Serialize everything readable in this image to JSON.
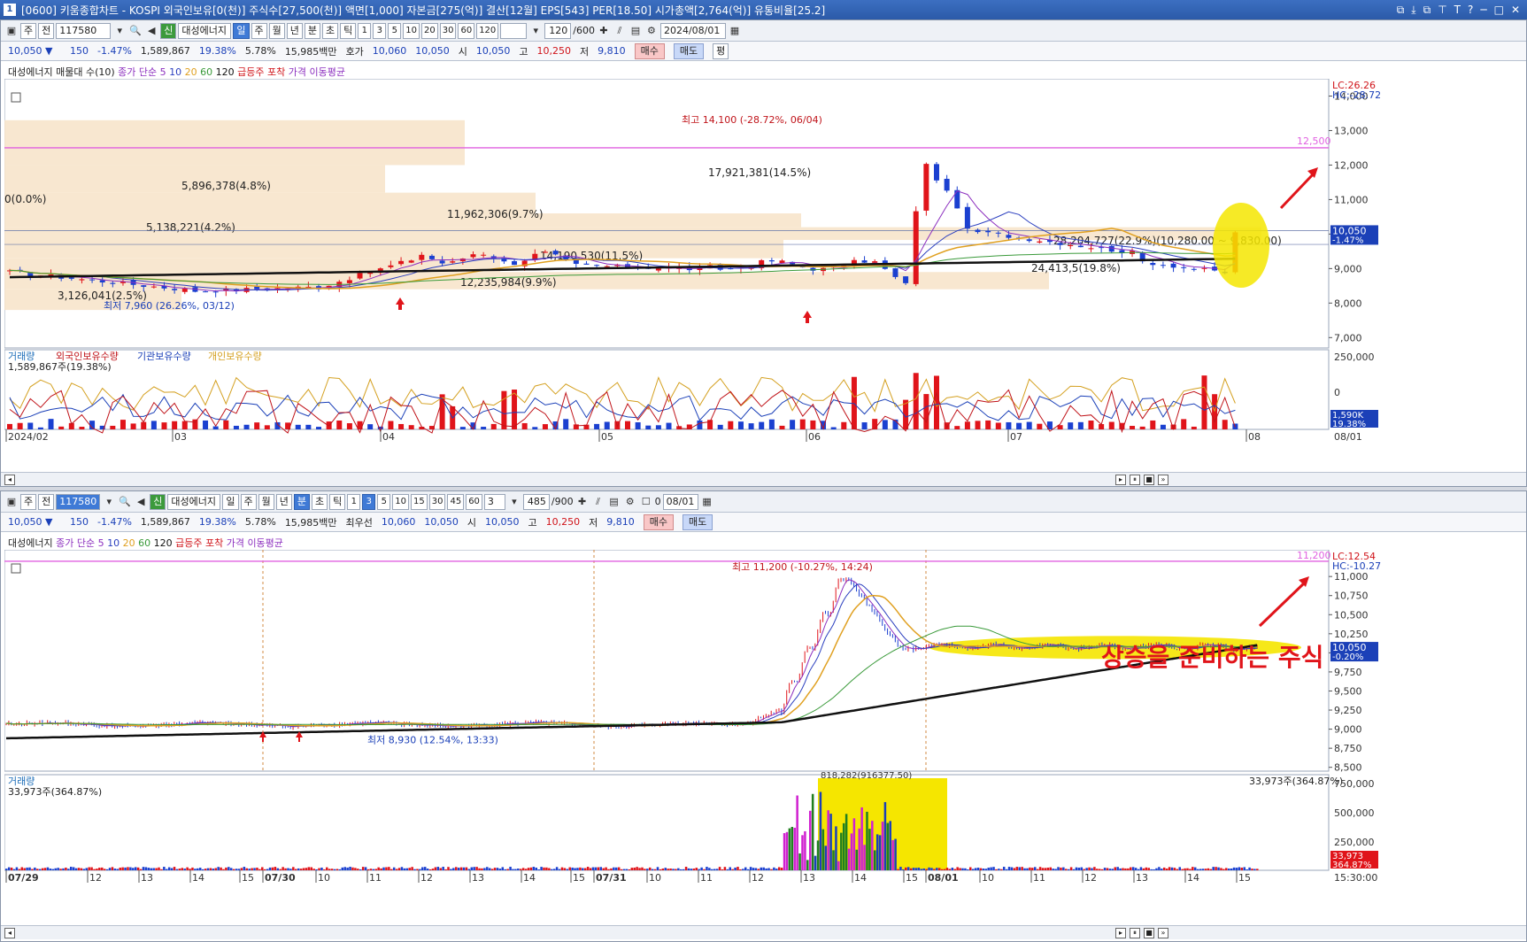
{
  "window": {
    "title": "[0600] 키움종합차트 - KOSPI 외국인보유[0(천)] 주식수[27,500(천)] 액면[1,000] 자본금[275(억)] 결산[12월] EPS[543] PER[18.50] 시가총액[2,764(억)] 유통비율[25.2]",
    "icon_label": "1",
    "controls": [
      "⧉",
      "⤓",
      "⧉",
      "⊤",
      "T",
      "?",
      "─",
      "□",
      "✕"
    ]
  },
  "top": {
    "toolbar": {
      "type_label": "주",
      "all_label": "전",
      "code": "117580",
      "mode_label": "신",
      "name": "대성에너지",
      "periods": [
        "일",
        "주",
        "월",
        "년",
        "분",
        "초",
        "틱"
      ],
      "active_period": "일",
      "nums": [
        "1",
        "3",
        "5",
        "10",
        "20",
        "30",
        "60",
        "120"
      ],
      "count": "120",
      "total": "/600",
      "date": "2024/08/01"
    },
    "quote": {
      "price": "10,050",
      "arrow": "▼",
      "change": "150",
      "rate": "-1.47%",
      "volume": "1,589,867",
      "ratio": "19.38%",
      "turnover": "5.78%",
      "amount": "15,985백만",
      "hoga_label": "호가",
      "ask": "10,060",
      "bid": "10,050",
      "open_label": "시",
      "open": "10,050",
      "high_label": "고",
      "high": "10,250",
      "low_label": "저",
      "low": "9,810",
      "buy": "매수",
      "sell": "매도",
      "avg": "평"
    },
    "legend": {
      "name": "대성에너지 매물대 수(10)",
      "ma_label": "종가 단순",
      "ma5": "5",
      "ma10": "10",
      "ma20": "20",
      "ma60": "60",
      "ma120": "120",
      "surge": "급등주 포착",
      "price_ma": "가격 이동평균"
    },
    "annotations": {
      "high": "최고 14,100 (-28.72%, 06/04)",
      "low": "최저 7,960 (26.26%, 03/12)",
      "line_value": "12,500",
      "lc": "LC:26.26",
      "hc": "HC:-28.72",
      "cur_price": "10,050",
      "cur_rate": "-1.47%"
    },
    "volume_profile": [
      {
        "label": "0(0.0%)"
      },
      {
        "label": "5,896,378(4.8%)"
      },
      {
        "label": "5,138,221(4.2%)"
      },
      {
        "label": "11,962,306(9.7%)"
      },
      {
        "label": "17,921,381(14.5%)"
      },
      {
        "label": "28,204,727(22.9%)(10,280.00 ~ 9,830.00)"
      },
      {
        "label": "14,190,530(11.5%)"
      },
      {
        "label": "12,235,984(9.9%)"
      },
      {
        "label": "24,413,5(19.8%)"
      },
      {
        "label": "3,126,041(2.5%)"
      }
    ],
    "price_axis": [
      "14,000",
      "13,000",
      "12,000",
      "11,000",
      "10,000",
      "9,000",
      "8,000",
      "7,000"
    ],
    "sub_legend": {
      "vol": "거래량",
      "foreign": "외국인보유수량",
      "inst": "기관보유수량",
      "indiv": "개인보유수량",
      "vol_value": "1,589,867주(19.38%)"
    },
    "sub_axis": [
      "250,000",
      "0"
    ],
    "sub_badge": "1,590K",
    "sub_badge_rate": "19.38%",
    "date_axis": [
      "2024/02",
      "03",
      "04",
      "05",
      "06",
      "07",
      "08"
    ],
    "date_right": "08/01"
  },
  "bottom": {
    "toolbar": {
      "type_label": "주",
      "all_label": "전",
      "code": "117580",
      "mode_label": "신",
      "name": "대성에너지",
      "periods": [
        "일",
        "주",
        "월",
        "년",
        "분",
        "초",
        "틱"
      ],
      "active_period": "분",
      "nums": [
        "1",
        "3",
        "5",
        "10",
        "15",
        "30",
        "45",
        "60"
      ],
      "active_num": "3",
      "interval": "3",
      "count": "485",
      "total": "/900",
      "date_check": "0",
      "date": "08/01"
    },
    "quote": {
      "price": "10,050",
      "arrow": "▼",
      "change": "150",
      "rate": "-1.47%",
      "volume": "1,589,867",
      "ratio": "19.38%",
      "turnover": "5.78%",
      "amount": "15,985백만",
      "hoga_label": "최우선",
      "ask": "10,060",
      "bid": "10,050",
      "open_label": "시",
      "open": "10,050",
      "high_label": "고",
      "high": "10,250",
      "low_label": "저",
      "low": "9,810",
      "buy": "매수",
      "sell": "매도"
    },
    "legend": {
      "name": "대성에너지",
      "ma_label": "종가 단순",
      "ma5": "5",
      "ma10": "10",
      "ma20": "20",
      "ma60": "60",
      "ma120": "120",
      "surge": "급등주 포착",
      "price_ma": "가격 이동평균"
    },
    "annotations": {
      "high": "최고 11,200 (-10.27%, 14:24)",
      "low": "최저 8,930 (12.54%, 13:33)",
      "line_value": "11,200",
      "lc": "LC:12.54",
      "hc": "HC:-10.27",
      "cur_price": "10,050",
      "cur_rate": "-0.20%",
      "korean": "상승을 준비하는 주식",
      "vol_peak": "818,282(916377.50)"
    },
    "price_axis": [
      "11,000",
      "10,750",
      "10,500",
      "10,250",
      "10,000",
      "9,750",
      "9,500",
      "9,250",
      "9,000",
      "8,750",
      "8,500"
    ],
    "sub_legend": {
      "vol": "거래량",
      "vol_value": "33,973주(364.87%)",
      "vol_value_right": "33,973주(364.87%)"
    },
    "sub_axis": [
      "750,000",
      "500,000",
      "250,000"
    ],
    "sub_badge": "33,973",
    "sub_badge_rate": "364.87%",
    "time_axis": [
      "07/29",
      "12",
      "13",
      "14",
      "15",
      "07/30",
      "10",
      "11",
      "12",
      "13",
      "14",
      "15",
      "07/31",
      "10",
      "11",
      "12",
      "13",
      "14",
      "15",
      "08/01",
      "10",
      "11",
      "12",
      "13",
      "14",
      "15"
    ],
    "time_right": "15:30:00"
  },
  "colors": {
    "up": "#e0141a",
    "down": "#1b40d0",
    "ma5": "#8c2fbf",
    "ma10": "#2b3fbf",
    "ma20": "#e0a020",
    "ma60": "#3a9a3a",
    "ma120": "#111111",
    "line_pink": "#e060e0",
    "highlight_yellow": "#f5e600",
    "profile": "#f7e3c8"
  }
}
